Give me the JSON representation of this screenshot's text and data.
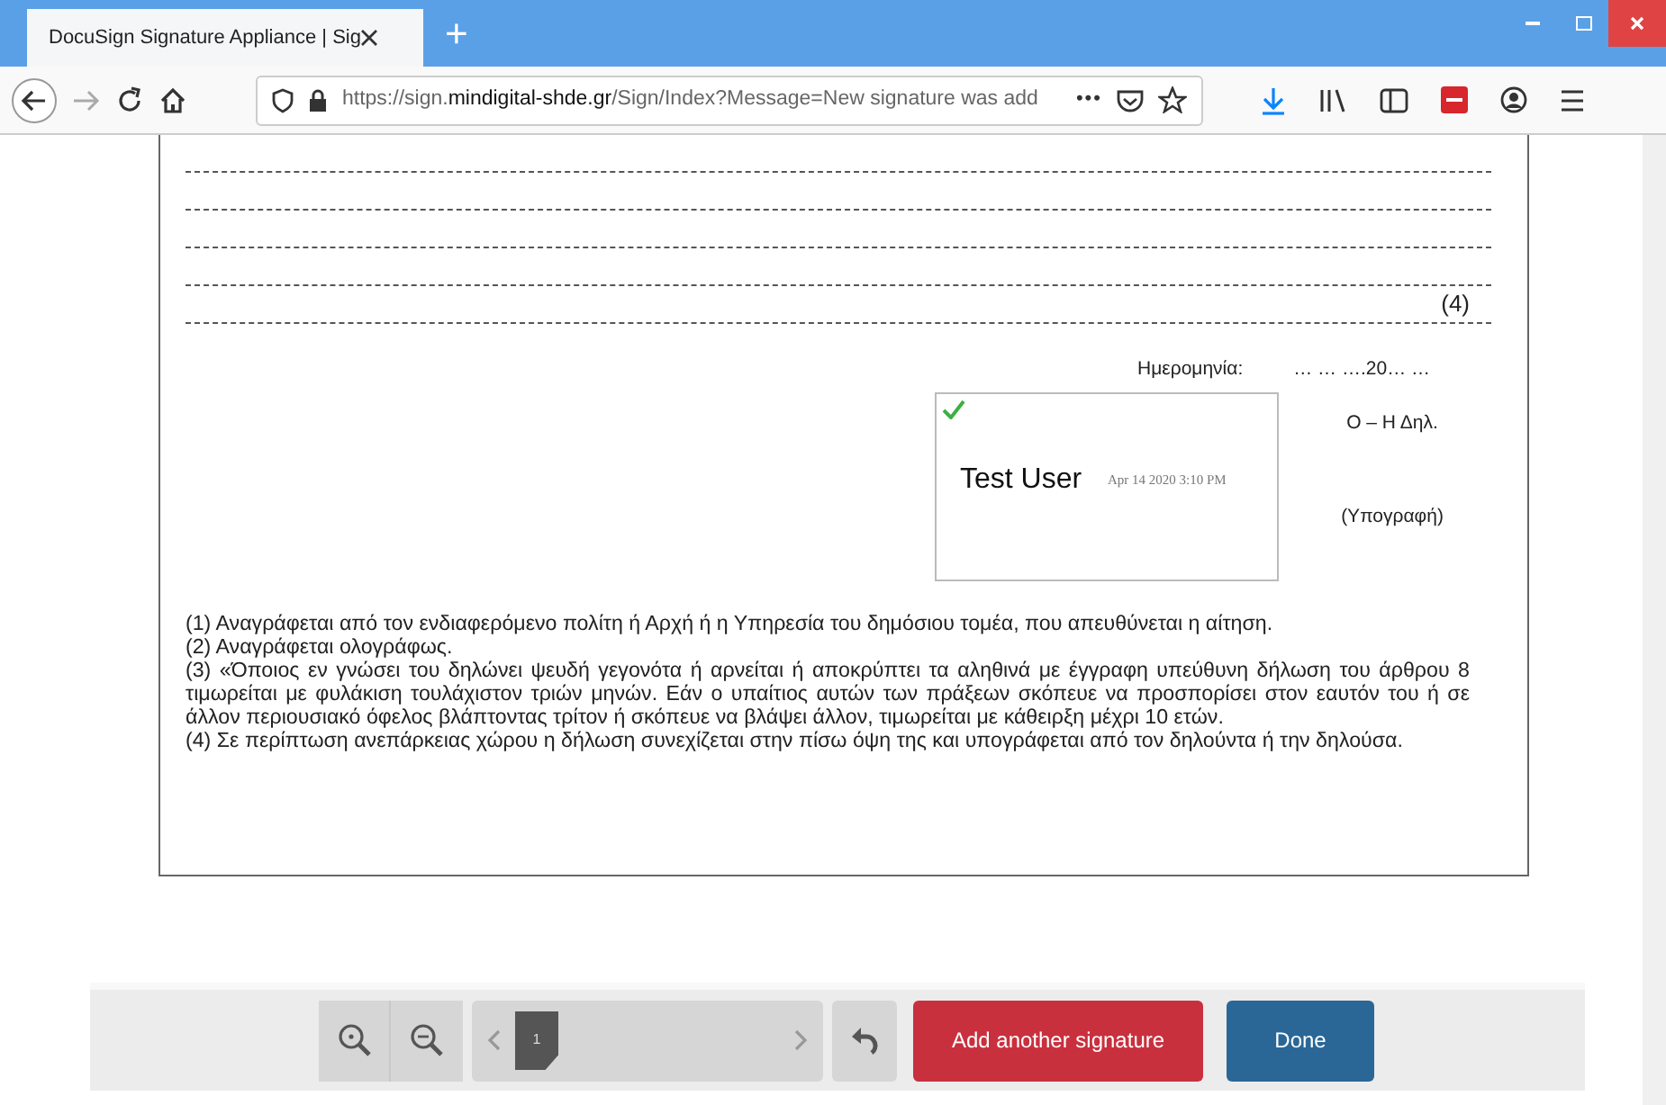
{
  "browser": {
    "tab_title": "DocuSign Signature Appliance | Sig",
    "new_tab": "+",
    "url": "https://sign.**mindigital-shde.gr**/Sign/Index?Message=New signature was add",
    "more": "•••"
  },
  "document": {
    "note_mark": "(4)",
    "date_label": "Ημερομηνία:",
    "date_value": "… … ….20… …",
    "declarant": "Ο – Η Δηλ.",
    "signature_caption": "(Υπογραφή)",
    "signature": {
      "signed": true,
      "signer": "Test User",
      "timestamp": "Apr 14 2020 3:10 PM"
    },
    "notes": [
      "(1) Αναγράφεται από τον ενδιαφερόμενο πολίτη ή Αρχή ή η Υπηρεσία του δημόσιου τομέα, που απευθύνεται η αίτηση.",
      "(2) Αναγράφεται ολογράφως.",
      "(3) «Όποιος εν γνώσει του δηλώνει ψευδή γεγονότα ή αρνείται ή αποκρύπτει τα αληθινά με έγγραφη υπεύθυνη δήλωση του άρθρου 8 τιμωρείται με φυλάκιση τουλάχιστον τριών μηνών. Εάν ο υπαίτιος αυτών των πράξεων σκόπευε να προσπορίσει στον εαυτόν του ή σε άλλον περιουσιακό όφελος βλάπτοντας τρίτον ή σκόπευε να βλάψει άλλον, τιμωρείται με κάθειρξη μέχρι 10 ετών.",
      "(4) Σε περίπτωση ανεπάρκειας χώρου η δήλωση συνεχίζεται στην πίσω όψη της και υπογράφεται από τον δηλούντα ή την δηλούσα."
    ]
  },
  "toolbar": {
    "page_number": "1",
    "buttons": [
      {
        "label": "Add another signature",
        "kind": "danger"
      },
      {
        "label": "Done",
        "kind": "primary"
      }
    ]
  }
}
